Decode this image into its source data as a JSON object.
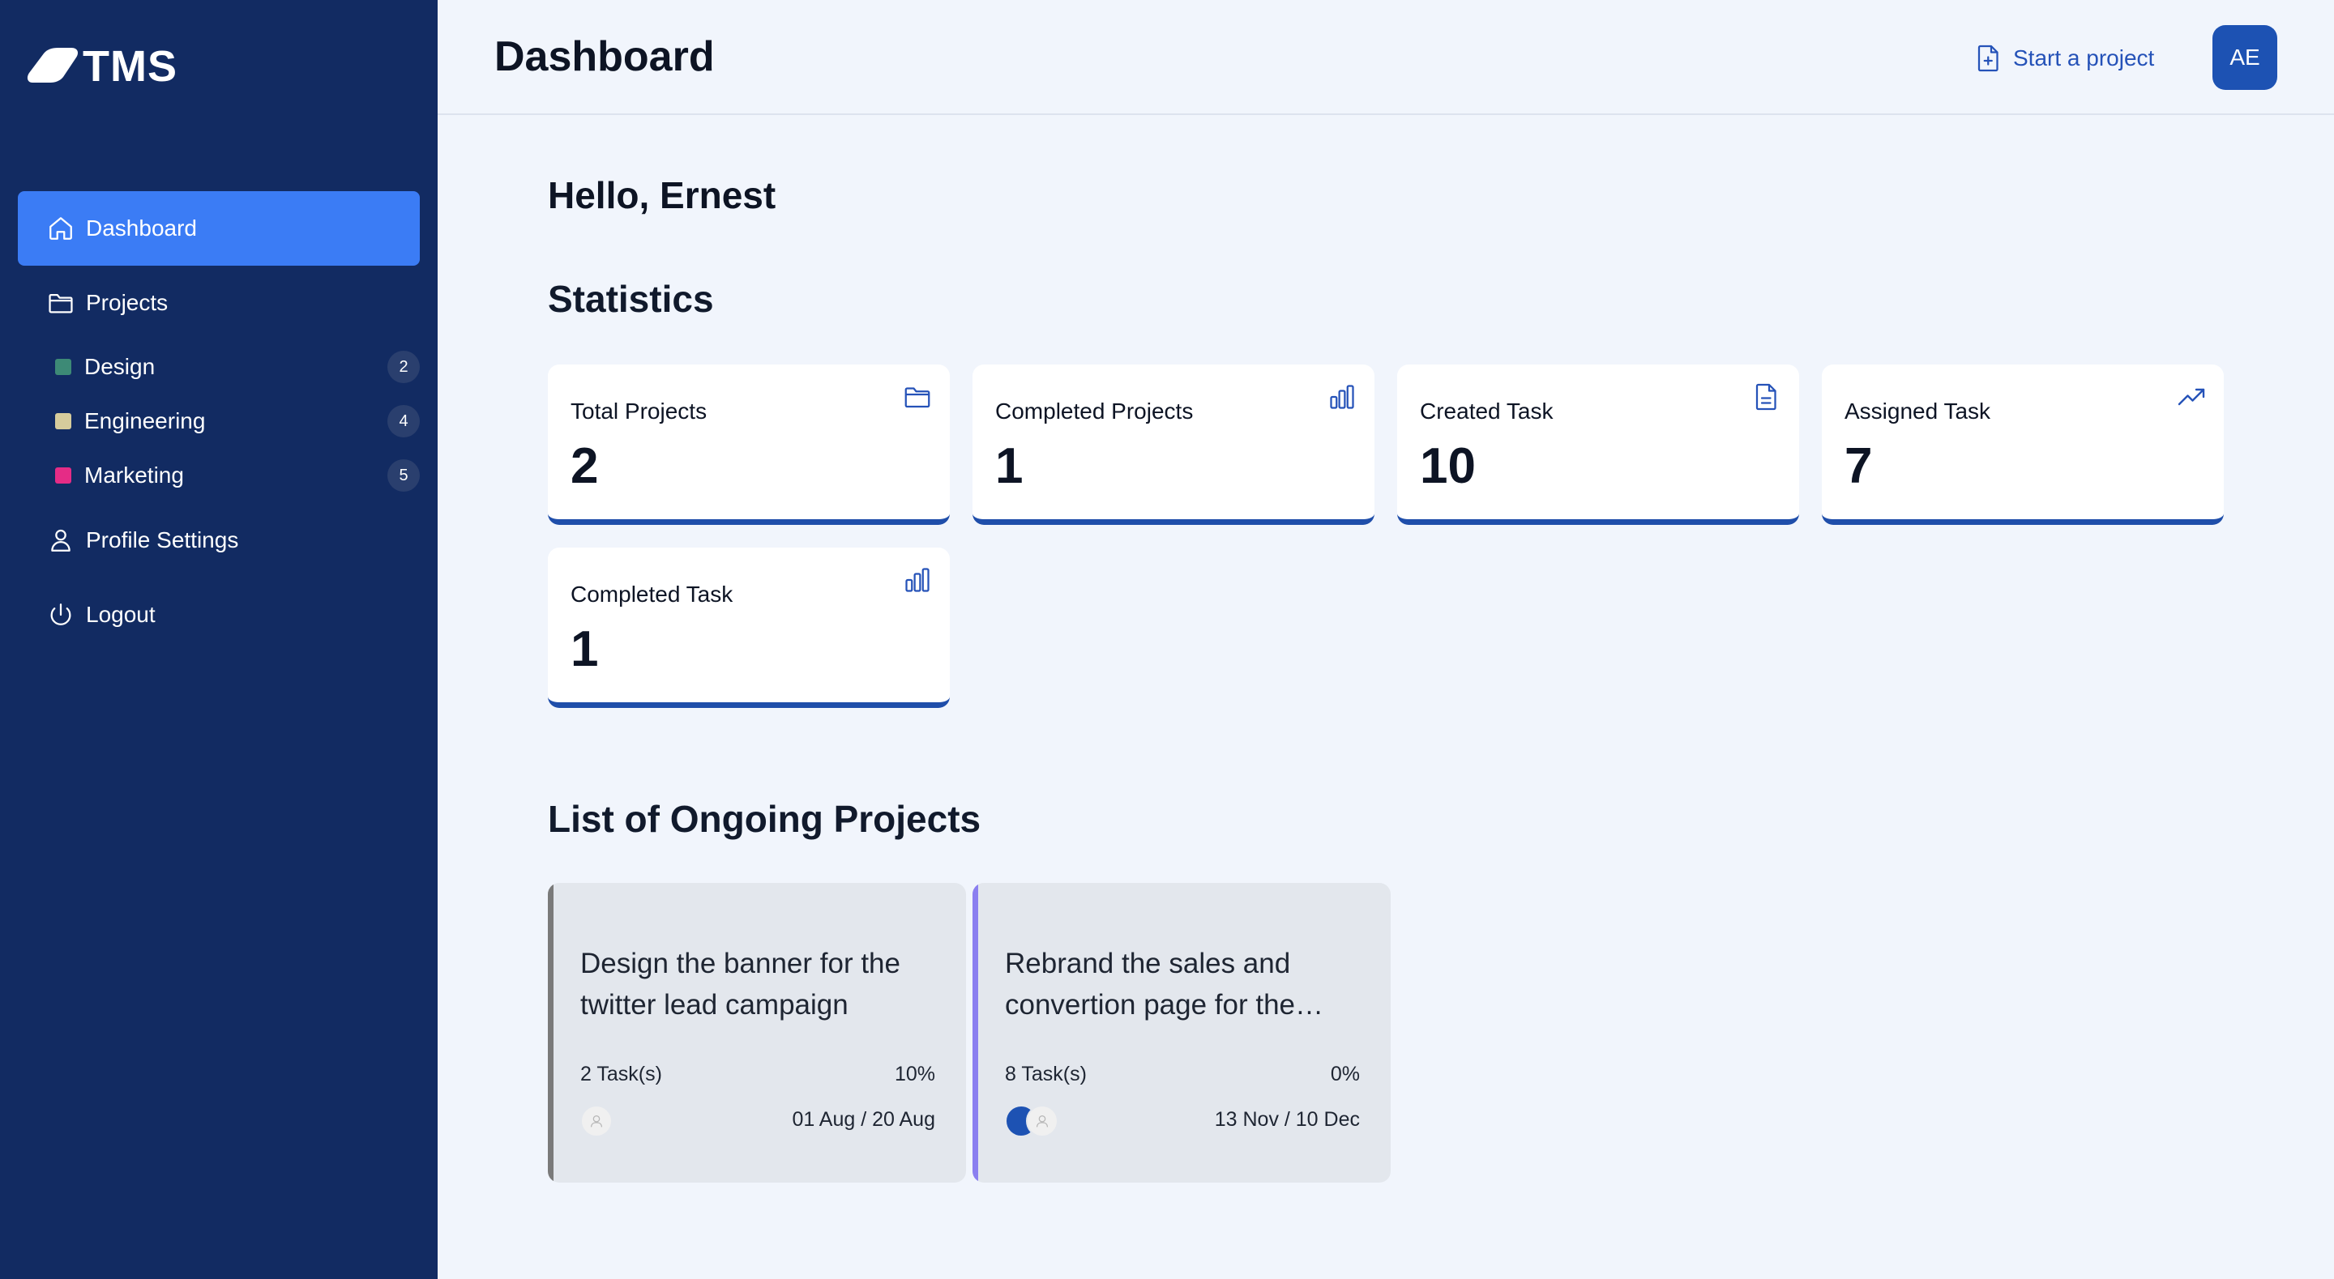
{
  "app": {
    "logo_text": "TMS"
  },
  "sidebar": {
    "nav": [
      {
        "label": "Dashboard",
        "icon": "home-icon",
        "active": true
      },
      {
        "label": "Projects",
        "icon": "folder-icon",
        "active": false
      }
    ],
    "projects": [
      {
        "label": "Design",
        "count": "2",
        "color": "#3d8a76"
      },
      {
        "label": "Engineering",
        "count": "4",
        "color": "#d6cc9c"
      },
      {
        "label": "Marketing",
        "count": "5",
        "color": "#e52c86"
      }
    ],
    "bottom_nav": [
      {
        "label": "Profile Settings",
        "icon": "user-icon"
      },
      {
        "label": "Logout",
        "icon": "power-icon"
      }
    ]
  },
  "header": {
    "title": "Dashboard",
    "start_project_label": "Start a project",
    "avatar_initials": "AE"
  },
  "main": {
    "greeting": "Hello, Ernest",
    "statistics_title": "Statistics",
    "stats": [
      {
        "label": "Total Projects",
        "value": "2",
        "icon": "folder-icon"
      },
      {
        "label": "Completed Projects",
        "value": "1",
        "icon": "bar-chart-icon"
      },
      {
        "label": "Created Task",
        "value": "10",
        "icon": "document-icon"
      },
      {
        "label": "Assigned Task",
        "value": "7",
        "icon": "trending-up-icon"
      },
      {
        "label": "Completed Task",
        "value": "1",
        "icon": "bar-chart-icon"
      }
    ],
    "ongoing_title": "List of Ongoing Projects",
    "projects": [
      {
        "title": "Design the banner for the twitter lead campaign",
        "tasks": "2 Task(s)",
        "progress": "10%",
        "progress_value": 10,
        "dates": "01 Aug / 20 Aug",
        "accent": "#7a7a7a"
      },
      {
        "title": "Rebrand the sales and convertion page for the…",
        "tasks": "8 Task(s)",
        "progress": "0%",
        "progress_value": 0,
        "dates": "13 Nov / 10 Dec",
        "accent": "#8b7ff0"
      }
    ]
  },
  "colors": {
    "sidebar_bg": "#122b62",
    "active_nav": "#3b7cf5",
    "accent_blue": "#1f4eaa",
    "page_bg": "#f1f5fc"
  }
}
